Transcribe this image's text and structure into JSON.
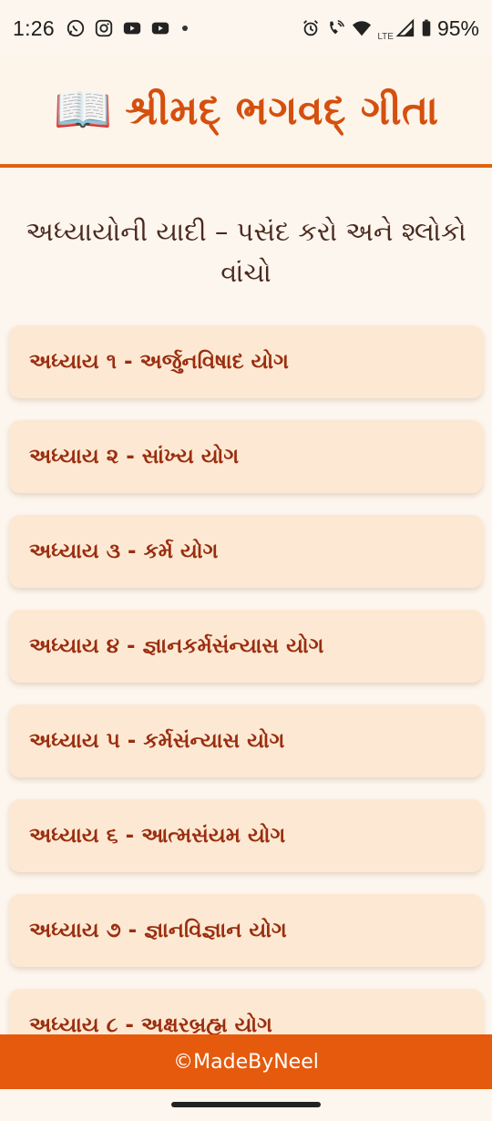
{
  "status_bar": {
    "time": "1:26",
    "battery": "95%",
    "network": "LTE",
    "left_icons": [
      "whatsapp-icon",
      "instagram-icon",
      "youtube-icon",
      "youtube-icon"
    ],
    "right_icons": [
      "alarm-icon",
      "wifi-calling-icon",
      "wifi-icon",
      "signal-icon",
      "battery-icon"
    ]
  },
  "header": {
    "icon": "📖",
    "title": "શ્રીમદ્ ભગવદ્ ગીતા"
  },
  "subtitle": "અધ્યાયોની યાદી – પસંદ કરો અને શ્લોકો વાંચો",
  "chapters": [
    {
      "label": "અધ્યાય ૧ - અર્જુનવિષાદ યોગ"
    },
    {
      "label": "અધ્યાય ૨ - સાંખ્ય યોગ"
    },
    {
      "label": "અધ્યાય ૩ - કર્મ યોગ"
    },
    {
      "label": "અધ્યાય ૪ - જ્ઞાનકર્મસંન્યાસ યોગ"
    },
    {
      "label": "અધ્યાય ૫ - કર્મસંન્યાસ યોગ"
    },
    {
      "label": "અધ્યાય ૬ - આત્મસંયમ યોગ"
    },
    {
      "label": "અધ્યાય ૭ - જ્ઞાનવિજ્ઞાન યોગ"
    },
    {
      "label": "અધ્યાય ૮ - અક્ષરબ્રહ્મ યોગ"
    }
  ],
  "footer": {
    "text": "©MadeByNeel"
  },
  "colors": {
    "accent": "#e55a0c",
    "title": "#d4500e",
    "card_bg": "#fde9d3",
    "card_text": "#9a2e10",
    "page_bg": "#fdf6ee"
  }
}
